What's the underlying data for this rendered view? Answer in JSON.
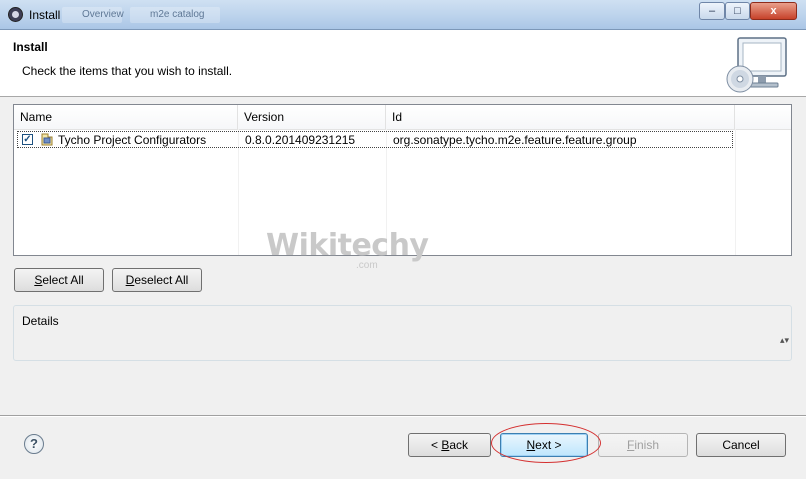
{
  "window": {
    "title": "Install",
    "background_tab_1": "Overview",
    "background_tab_2": "m2e catalog",
    "minimize_label": "–",
    "maximize_label": "□",
    "close_label": "x"
  },
  "header": {
    "title": "Install",
    "subtitle": "Check the items that you wish to install."
  },
  "table": {
    "columns": [
      "Name",
      "Version",
      "Id"
    ],
    "rows": [
      {
        "checked": true,
        "check_mark": "✓",
        "name": "Tycho Project Configurators",
        "version": "0.8.0.201409231215",
        "id": "org.sonatype.tycho.m2e.feature.feature.group"
      }
    ]
  },
  "selection_buttons": {
    "select_all": {
      "mnemonic": "S",
      "rest": "elect All"
    },
    "deselect_all": {
      "mnemonic": "D",
      "rest": "eselect All"
    }
  },
  "details": {
    "label": "Details",
    "scroll_glyph": "▴▾"
  },
  "footer": {
    "help_glyph": "?",
    "back": {
      "prefix": "< ",
      "mnemonic": "B",
      "rest": "ack"
    },
    "next": {
      "mnemonic": "N",
      "rest": "ext >"
    },
    "finish": {
      "mnemonic": "F",
      "rest": "inish"
    },
    "cancel": "Cancel"
  },
  "watermark": {
    "text": "Wikitechy",
    "domain": ".com"
  },
  "icons": {
    "app": "eclipse-icon",
    "header": "monitor-cd-icon",
    "feature": "plugin-feature-icon",
    "help": "help-icon"
  },
  "colors": {
    "highlight": "#d43030",
    "default_button": "#bee6fd",
    "title_bar": "#bcd3ec"
  }
}
